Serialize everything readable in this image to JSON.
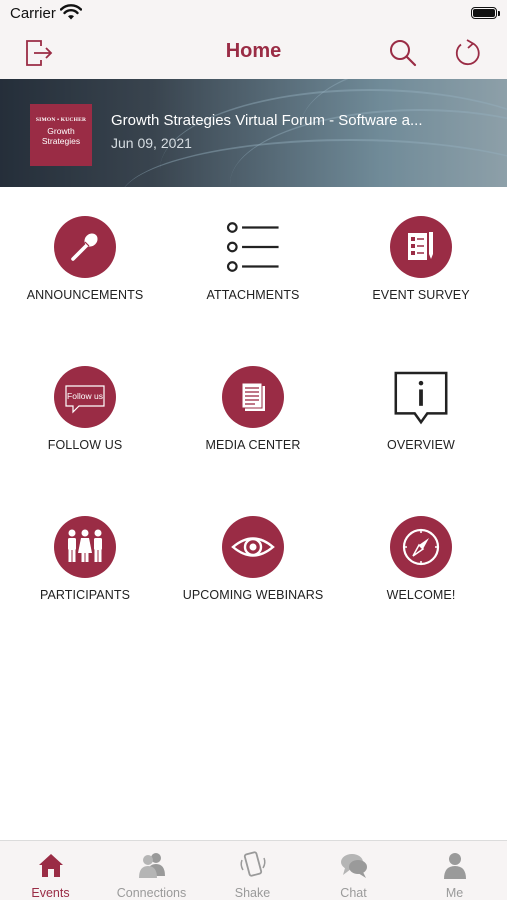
{
  "status_bar": {
    "carrier": "Carrier"
  },
  "nav": {
    "title": "Home",
    "icons": {
      "left": "logout-icon",
      "search": "search-icon",
      "refresh": "refresh-icon"
    }
  },
  "event": {
    "logo_firm": "SIMON • KUCHER",
    "logo_name_line1": "Growth",
    "logo_name_line2": "Strategies",
    "title": "Growth Strategies Virtual Forum - Software a...",
    "date": "Jun 09, 2021"
  },
  "tiles": [
    {
      "label": "ANNOUNCEMENTS",
      "icon": "microphone-icon"
    },
    {
      "label": "ATTACHMENTS",
      "icon": "list-icon"
    },
    {
      "label": "EVENT SURVEY",
      "icon": "survey-icon"
    },
    {
      "label": "FOLLOW US",
      "icon": "speech-bubble-icon",
      "icon_text": "Follow us"
    },
    {
      "label": "MEDIA CENTER",
      "icon": "documents-icon"
    },
    {
      "label": "OVERVIEW",
      "icon": "info-icon"
    },
    {
      "label": "PARTICIPANTS",
      "icon": "people-icon"
    },
    {
      "label": "UPCOMING WEBINARS",
      "icon": "eye-icon"
    },
    {
      "label": "WELCOME!",
      "icon": "compass-icon"
    }
  ],
  "tabs": [
    {
      "label": "Events",
      "icon": "home-icon",
      "active": true
    },
    {
      "label": "Connections",
      "icon": "connections-icon",
      "active": false
    },
    {
      "label": "Shake",
      "icon": "shake-icon",
      "active": false
    },
    {
      "label": "Chat",
      "icon": "chat-icon",
      "active": false
    },
    {
      "label": "Me",
      "icon": "user-icon",
      "active": false
    }
  ],
  "colors": {
    "accent": "#9a2c45",
    "tab_inactive": "#9a9a9a",
    "bar_background": "#f7f4f4"
  }
}
